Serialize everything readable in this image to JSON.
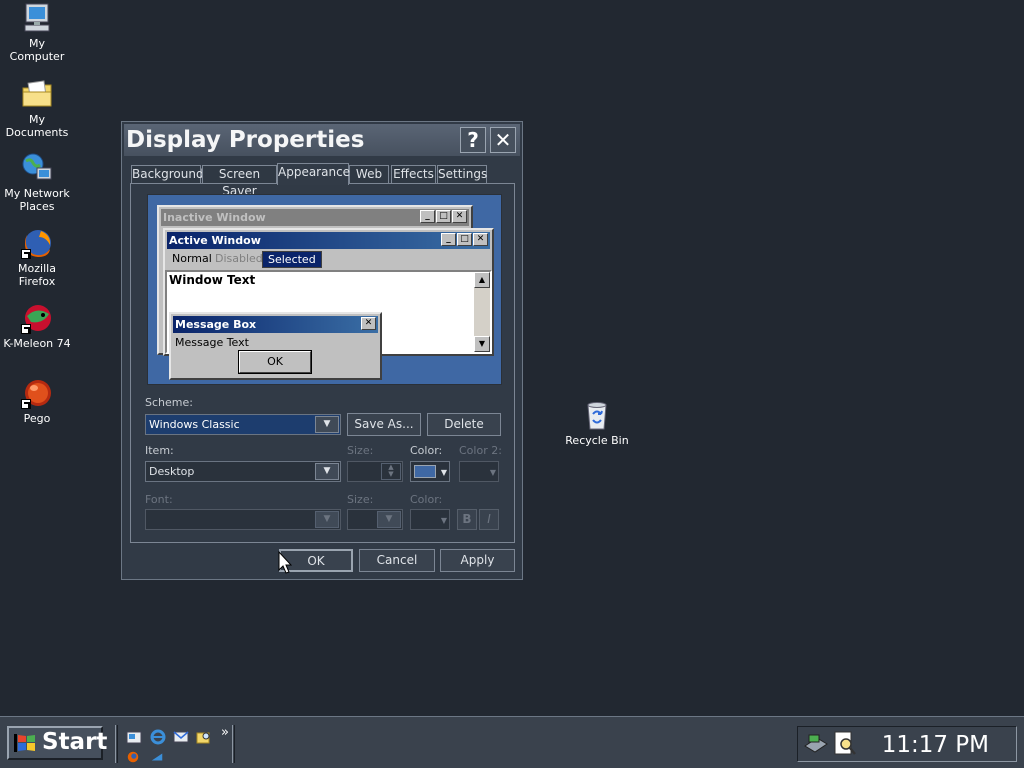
{
  "desktop": {
    "icons": [
      {
        "label": "My Computer"
      },
      {
        "label": "My Documents"
      },
      {
        "label": "My Network Places"
      },
      {
        "label": "Mozilla Firefox"
      },
      {
        "label": "K-Meleon 74"
      },
      {
        "label": "Pego"
      },
      {
        "label": "Recycle Bin"
      }
    ]
  },
  "dialog": {
    "title": "Display Properties",
    "help_glyph": "?",
    "close_glyph": "✕",
    "tabs": [
      "Background",
      "Screen Saver",
      "Appearance",
      "Web",
      "Effects",
      "Settings"
    ],
    "active_tab": "Appearance",
    "preview": {
      "inactive_title": "Inactive Window",
      "active_title": "Active Window",
      "menu": [
        "Normal",
        "Disabled",
        "Selected"
      ],
      "window_text": "Window Text",
      "msgbox_title": "Message Box",
      "msgbox_text": "Message Text",
      "msgbox_ok": "OK"
    },
    "scheme": {
      "label": "Scheme:",
      "value": "Windows Classic",
      "save_as": "Save As...",
      "delete": "Delete"
    },
    "item": {
      "label": "Item:",
      "value": "Desktop",
      "size_label": "Size:",
      "color_label": "Color:",
      "color2_label": "Color 2:",
      "color_value": "#3f68a4"
    },
    "font": {
      "label": "Font:",
      "size_label": "Size:",
      "color_label": "Color:",
      "bold": "B",
      "italic": "I"
    },
    "buttons": {
      "ok": "OK",
      "cancel": "Cancel",
      "apply": "Apply"
    }
  },
  "taskbar": {
    "start_label": "Start",
    "chevron": "»",
    "clock": "11:17 PM"
  },
  "colors": {
    "desktop": "#222831",
    "active_title": "#0a246a",
    "inactive_title": "#808080",
    "preview_bg": "#3f68a4"
  }
}
